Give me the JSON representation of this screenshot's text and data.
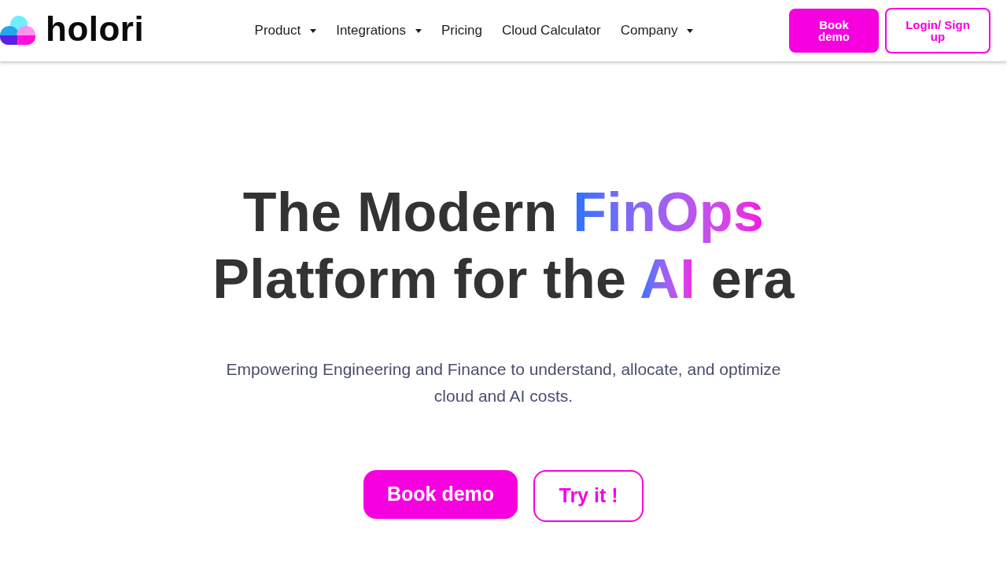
{
  "header": {
    "logo": {
      "text": "holori"
    },
    "nav": [
      {
        "label": "Product",
        "has_dropdown": true
      },
      {
        "label": "Integrations",
        "has_dropdown": true
      },
      {
        "label": "Pricing",
        "has_dropdown": false
      },
      {
        "label": "Cloud Calculator",
        "has_dropdown": false
      },
      {
        "label": "Company",
        "has_dropdown": true
      }
    ],
    "buttons": [
      {
        "label": "Book demo",
        "kind": "filled"
      },
      {
        "label": "Login/ Sign up",
        "kind": "outline"
      }
    ]
  },
  "hero": {
    "headline": [
      {
        "text": "The Modern ",
        "highlighted": false
      },
      {
        "text": "FinOps",
        "highlighted": true
      },
      {
        "text": " Platform for the ",
        "highlighted": false
      },
      {
        "text": "AI",
        "highlighted": true
      },
      {
        "text": " era",
        "highlighted": false
      }
    ],
    "subtitle": "Empowering Engineering and Finance to understand, allocate, and optimize cloud and AI costs.",
    "buttons": [
      {
        "label": "Book demo",
        "kind": "filled"
      },
      {
        "label": "Try it !",
        "kind": "outline"
      }
    ]
  }
}
